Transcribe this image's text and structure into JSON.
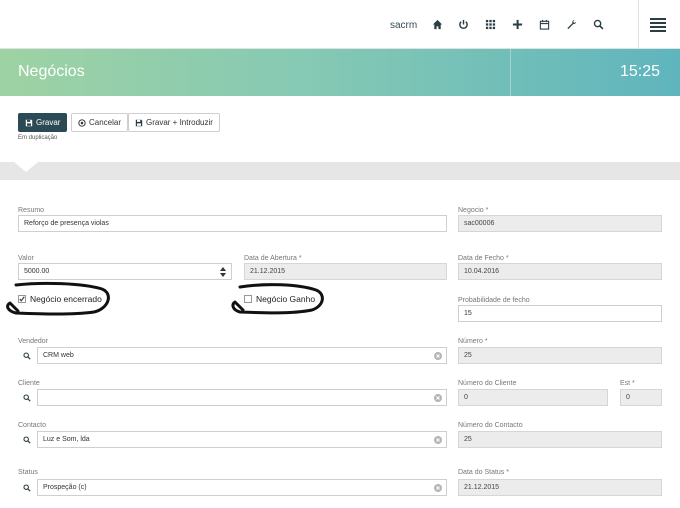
{
  "app": {
    "brand_text": "",
    "name": "sacrm"
  },
  "topnav": {
    "icons": [
      "home-icon",
      "power-icon",
      "apps-grid-icon",
      "plus-icon",
      "calendar-icon",
      "wrench-icon",
      "search-icon",
      "menu-icon"
    ]
  },
  "header": {
    "title": "Negócios",
    "clock": "15:25"
  },
  "toolbar": {
    "save_label": "Gravar",
    "cancel_label": "Cancelar",
    "save_insert_label": "Gravar + Introduzir",
    "note": "Em duplicação"
  },
  "form": {
    "resumo": {
      "label": "Resumo",
      "value": "Reforço de presença violas"
    },
    "negocio": {
      "label": "Negocio *",
      "value": "sac00006"
    },
    "valor": {
      "label": "Valor",
      "value": "5000.00"
    },
    "data_abertura": {
      "label": "Data de Abertura *",
      "value": "21.12.2015"
    },
    "data_fecho": {
      "label": "Data de Fecho *",
      "value": "10.04.2016"
    },
    "negocio_encerrado": {
      "label": "Negócio encerrado",
      "checked": true
    },
    "negocio_ganho": {
      "label": "Negócio Ganho",
      "checked": false
    },
    "probabilidade": {
      "label": "Probabilidade de fecho",
      "value": "15"
    },
    "vendedor": {
      "label": "Vendedor",
      "value": "CRM web"
    },
    "numero": {
      "label": "Número *",
      "value": "25"
    },
    "cliente": {
      "label": "Cliente",
      "value": ""
    },
    "numero_cliente": {
      "label": "Número do Cliente",
      "value": "0"
    },
    "est": {
      "label": "Est *",
      "value": "0"
    },
    "contacto": {
      "label": "Contacto",
      "value": "Luz e Som, lda"
    },
    "numero_contacto": {
      "label": "Número do Contacto",
      "value": "25"
    },
    "status": {
      "label": "Status",
      "value": "Prospeção (c)"
    },
    "data_status": {
      "label": "Data do Status *",
      "value": "21.12.2015"
    }
  },
  "colors": {
    "primary": "#2c4a55",
    "banner_start": "#9ed2a3",
    "banner_end": "#5fb5bd"
  }
}
